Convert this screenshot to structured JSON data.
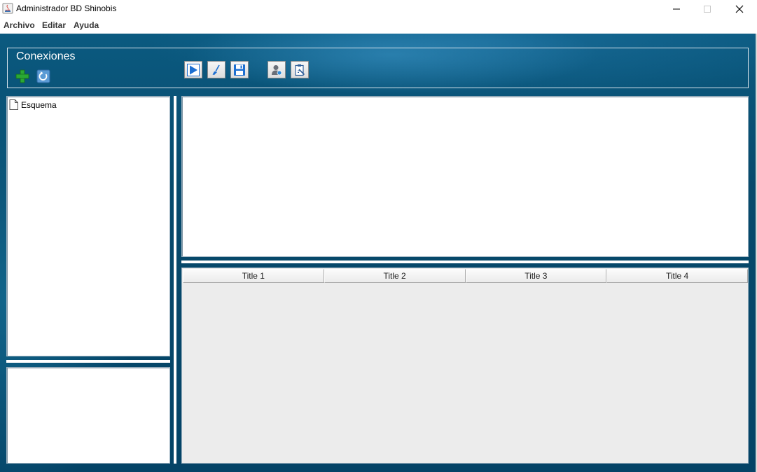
{
  "window": {
    "title": "Administrador BD Shinobis"
  },
  "menubar": {
    "items": [
      "Archivo",
      "Editar",
      "Ayuda"
    ]
  },
  "toolbar": {
    "title": "Conexiones",
    "buttons": [
      "add-icon",
      "refresh-icon",
      "run-icon",
      "clear-icon",
      "save-icon",
      "user-icon",
      "clipboard-icon"
    ]
  },
  "tree": {
    "root": "Esquema"
  },
  "table": {
    "columns": [
      "Title 1",
      "Title 2",
      "Title 3",
      "Title 4"
    ]
  },
  "colors": {
    "background": "#074a6c",
    "accent": "#1d6fd1"
  }
}
